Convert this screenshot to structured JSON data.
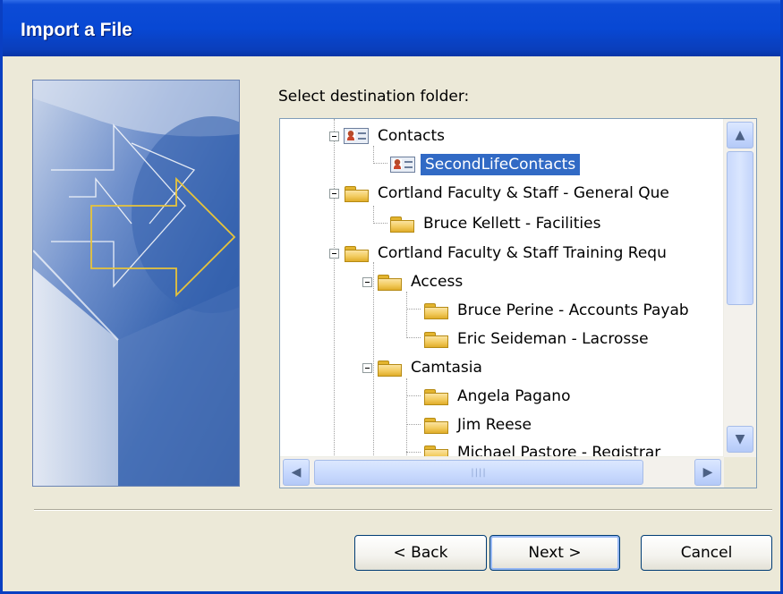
{
  "window": {
    "title": "Import a File"
  },
  "content": {
    "prompt": "Select destination folder:",
    "tree": [
      {
        "label": "Contacts",
        "icon": "contacts-icon",
        "expanded": true
      },
      {
        "label": "SecondLifeContacts",
        "icon": "contacts-icon",
        "selected": true
      },
      {
        "label": "Cortland Faculty & Staff - General Que",
        "icon": "folder-icon",
        "expanded": true
      },
      {
        "label": "Bruce Kellett - Facilities",
        "icon": "folder-icon"
      },
      {
        "label": "Cortland Faculty & Staff Training Requ",
        "icon": "folder-icon",
        "expanded": true
      },
      {
        "label": "Access",
        "icon": "folder-icon",
        "expanded": true
      },
      {
        "label": "Bruce Perine - Accounts Payab",
        "icon": "folder-icon"
      },
      {
        "label": "Eric Seideman - Lacrosse",
        "icon": "folder-icon"
      },
      {
        "label": "Camtasia",
        "icon": "folder-icon",
        "expanded": true
      },
      {
        "label": "Angela Pagano",
        "icon": "folder-icon"
      },
      {
        "label": "Jim Reese",
        "icon": "folder-icon"
      },
      {
        "label": "Michael Pastore - Registrar",
        "icon": "folder-icon"
      }
    ]
  },
  "buttons": {
    "back": "< Back",
    "next": "Next >",
    "cancel": "Cancel"
  },
  "colors": {
    "titlebar": "#0848D4",
    "selection": "#316AC5",
    "dialog_bg": "#ECE9D8"
  }
}
